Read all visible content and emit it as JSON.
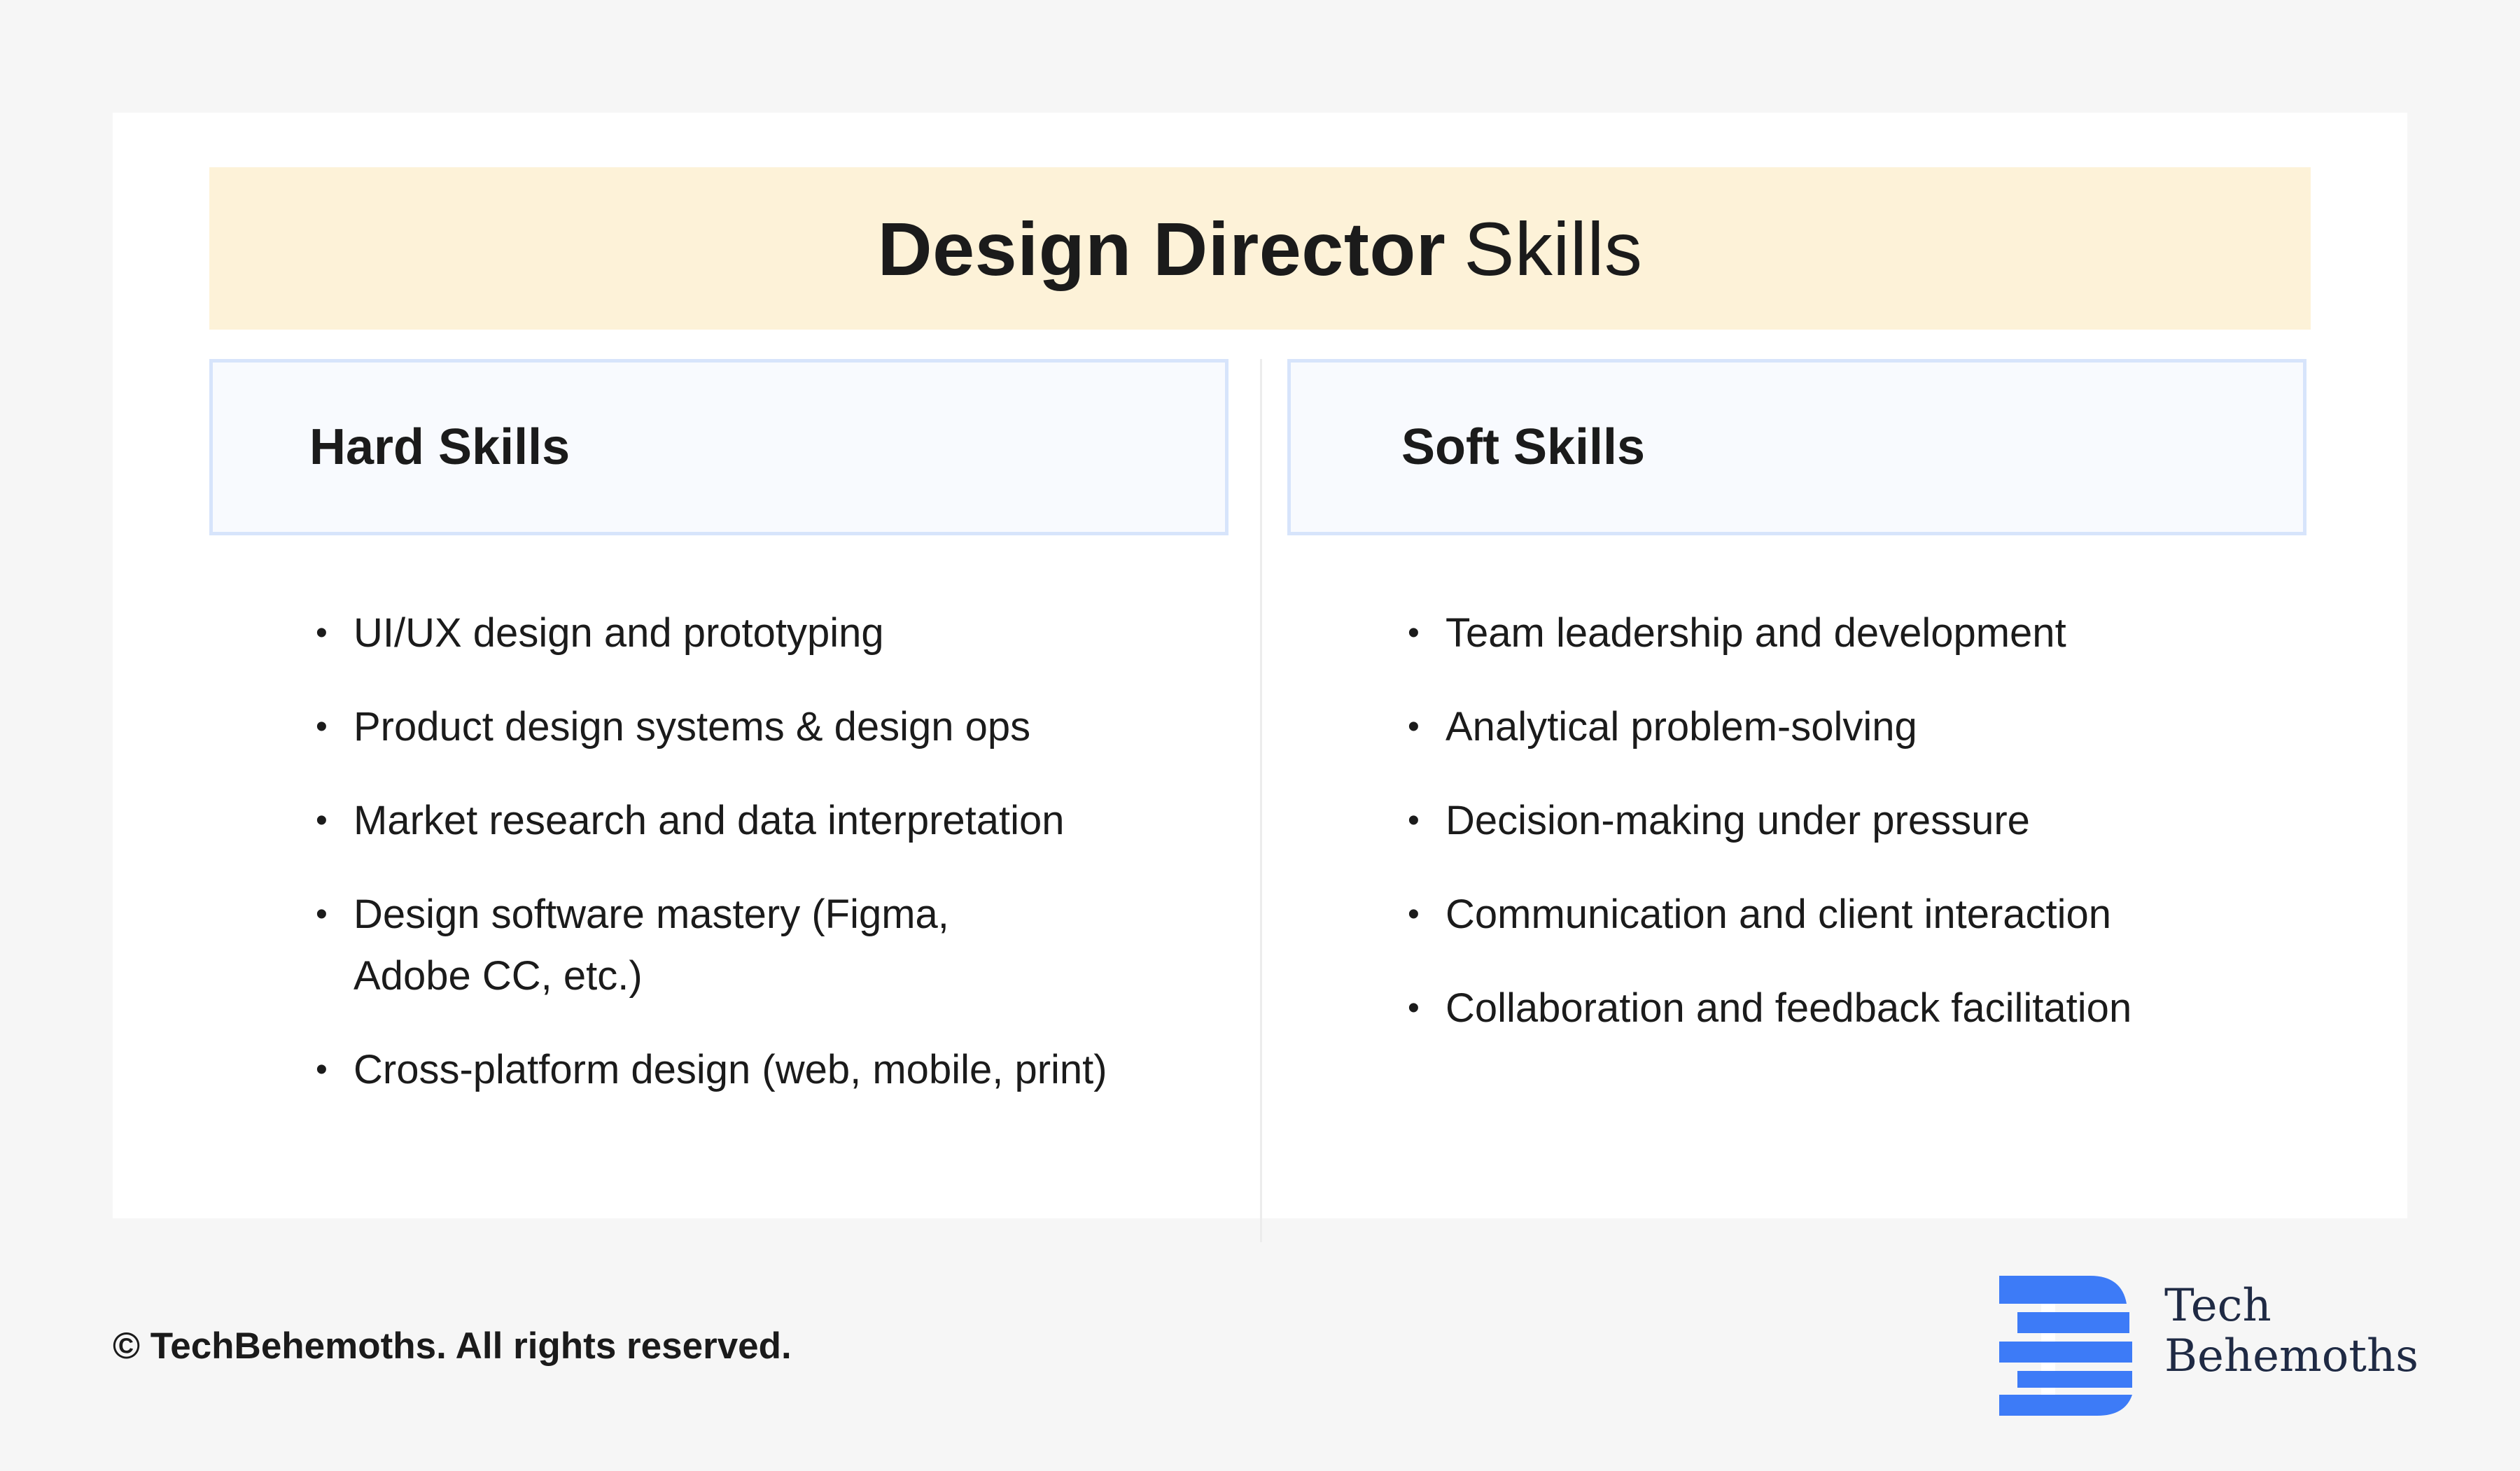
{
  "title": {
    "bold": "Design Director",
    "light": "Skills"
  },
  "columns": {
    "hard": {
      "header": "Hard Skills",
      "items": [
        "UI/UX design and prototyping",
        "Product design systems & design ops",
        "Market research and data interpretation",
        "Design software mastery (Figma, Adobe CC, etc.)",
        "Cross-platform design (web, mobile, print)"
      ]
    },
    "soft": {
      "header": "Soft Skills",
      "items": [
        "Team leadership and development",
        "Analytical problem-solving",
        "Decision-making under pressure",
        "Communication and client interaction",
        "Collaboration and feedback facilitation"
      ]
    }
  },
  "bullet": "•",
  "footer": {
    "copyright": "© TechBehemoths. All rights reserved."
  },
  "brand": {
    "line1": "Tech",
    "line2": "Behemoths",
    "logo_icon": "techbehemoths-logo-icon",
    "logo_color": "#3d7bf7"
  },
  "colors": {
    "banner": "#fdf2d8",
    "header_border": "#d7e4fb",
    "header_bg": "#f8fafe"
  }
}
